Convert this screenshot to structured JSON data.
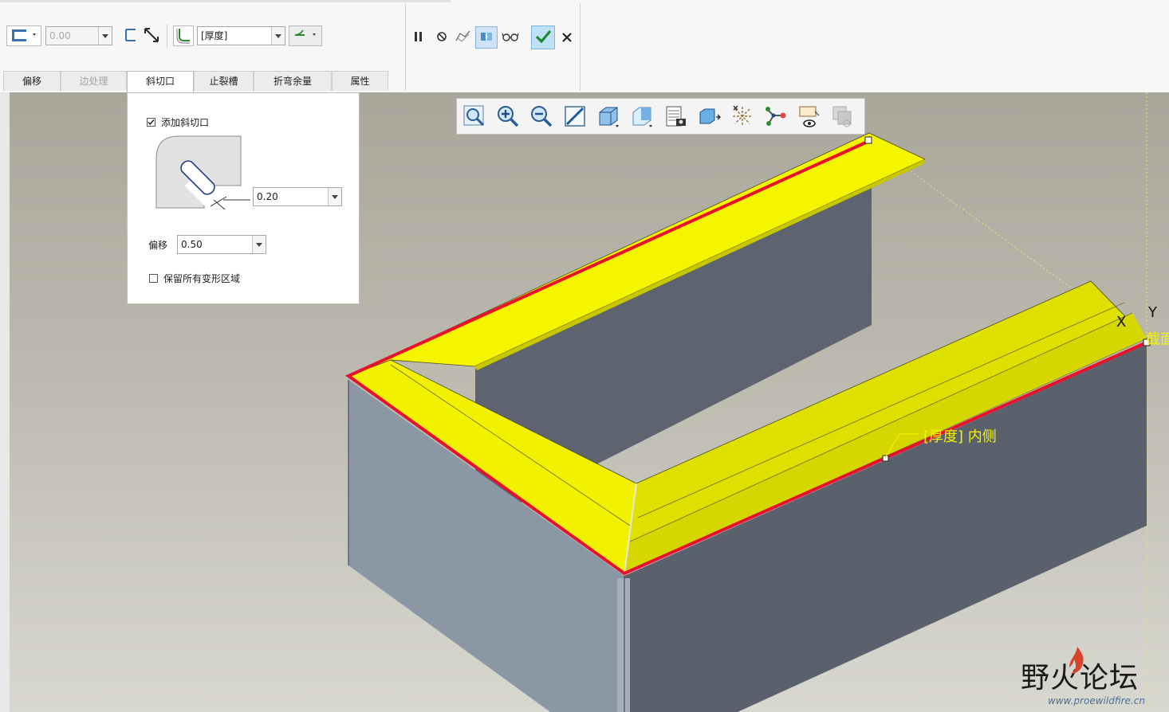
{
  "toolbar": {
    "offset_value": "0.00",
    "thickness_option": "[厚度]",
    "tabs": [
      {
        "label": "偏移",
        "state": "normal"
      },
      {
        "label": "边处理",
        "state": "disabled"
      },
      {
        "label": "斜切口",
        "state": "active"
      },
      {
        "label": "止裂槽",
        "state": "normal"
      },
      {
        "label": "折弯余量",
        "state": "normal"
      },
      {
        "label": "属性",
        "state": "normal"
      }
    ],
    "icons": [
      "pause-icon",
      "stop-icon",
      "verify-icon",
      "preview-icon",
      "glasses-icon",
      "confirm-check-icon",
      "cancel-x-icon"
    ]
  },
  "miter_panel": {
    "add_miter_label": "添加斜切口",
    "add_miter_checked": true,
    "width_value": "0.20",
    "offset_label": "偏移",
    "offset_value": "0.50",
    "keep_regions_label": "保留所有变形区域",
    "keep_regions_checked": false
  },
  "view_toolbar": {
    "icons": [
      "zoom-to-fit-icon",
      "zoom-in-icon",
      "zoom-out-icon",
      "repaint-icon",
      "display-style-icon",
      "saved-orientations-icon",
      "view-manager-icon",
      "perspective-icon",
      "spin-center-icon",
      "datum-display-icon",
      "annotation-display-icon",
      "appearance-icon"
    ]
  },
  "viewport": {
    "annotation": "[厚度] 内侧",
    "axis_x": "X",
    "axis_y": "Y",
    "clipped_label": "截面",
    "highlight_color": "#f5f500",
    "edge_color": "#e8102a",
    "body_color": "#5b616c"
  },
  "watermark": {
    "forum_name": "野火论坛",
    "url": "www.proewildfire.cn"
  }
}
